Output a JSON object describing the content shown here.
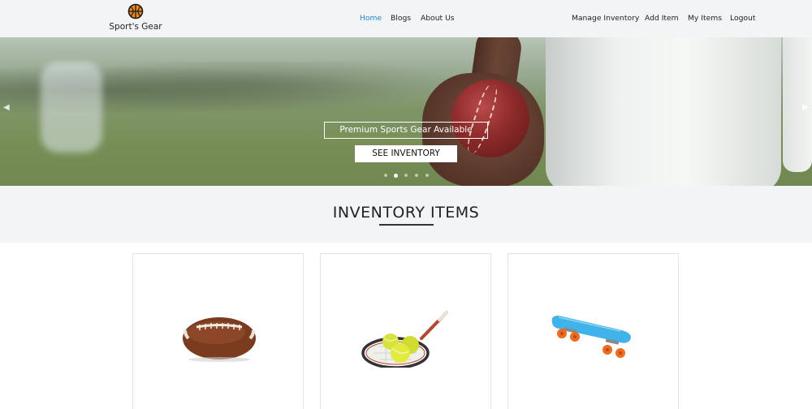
{
  "navbar": {
    "brand_text": "Sport's Gear",
    "brand_icon": "basketball-logo-icon",
    "left_links": [
      {
        "label": "Home",
        "active": true
      },
      {
        "label": "Blogs",
        "active": false
      },
      {
        "label": "About Us",
        "active": false
      }
    ],
    "right_links": [
      {
        "label": "Manage Inventory"
      },
      {
        "label": "Add Item"
      },
      {
        "label": "My Items"
      },
      {
        "label": "Logout"
      }
    ],
    "active_color": "#1e88d6"
  },
  "hero": {
    "caption": "Premium Sports Gear Available",
    "button_label": "SEE INVENTORY",
    "slide_count": 5,
    "active_slide": 2,
    "prev_icon": "chevron-left-icon",
    "next_icon": "chevron-right-icon"
  },
  "inventory": {
    "title": "INVENTORY ITEMS",
    "items": [
      {
        "image": "american-football-icon"
      },
      {
        "image": "tennis-racket-balls-icon"
      },
      {
        "image": "skateboard-icon"
      }
    ]
  }
}
